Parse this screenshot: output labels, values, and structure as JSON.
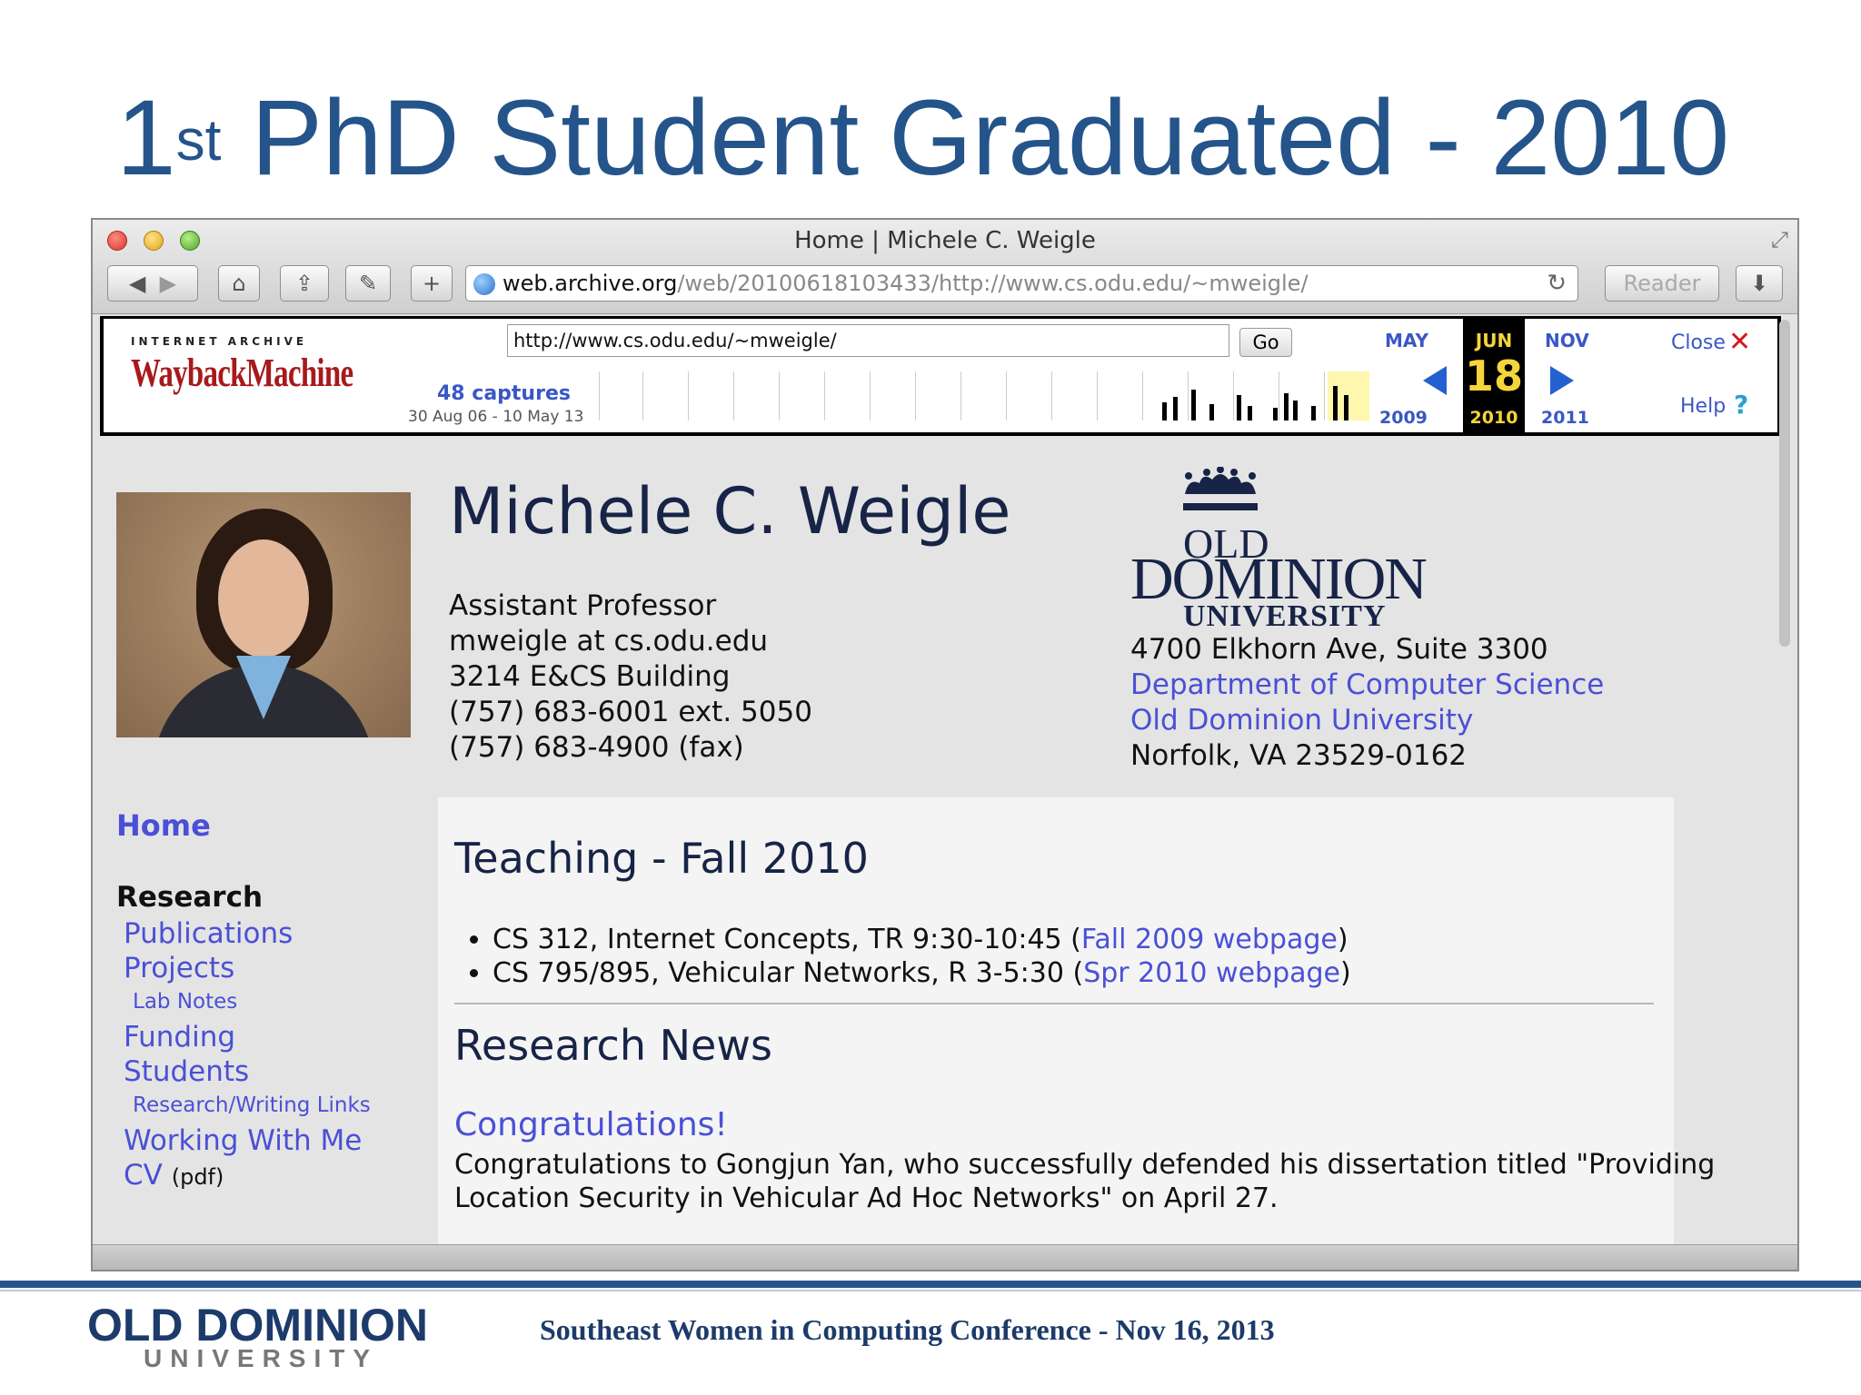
{
  "slide": {
    "title_number": "1",
    "title_sup": "st",
    "title_rest": " PhD Student Graduated - 2010",
    "footer_org_line1": "OLD DOMINION",
    "footer_org_line2": "UNIVERSITY",
    "footer_conference": "Southeast Women in Computing Conference - Nov 16, 2013"
  },
  "browser": {
    "window_title": "Home | Michele C. Weigle",
    "url_domain": "web.archive.org",
    "url_path": "/web/20100618103433/http://www.cs.odu.edu/~mweigle/",
    "reader_label": "Reader",
    "toolbar_icons": [
      "back-icon",
      "forward-icon",
      "home-icon",
      "share-icon",
      "bookmark-icon",
      "add-icon",
      "reload-icon",
      "download-icon"
    ]
  },
  "wayback": {
    "ia_label": "INTERNET ARCHIVE",
    "logo_text": "WaybackMachine",
    "url_input": "http://www.cs.odu.edu/~mweigle/",
    "go_label": "Go",
    "captures": "48 captures",
    "capture_range": "30 Aug 06 - 10 May 13",
    "prev_month": "MAY",
    "prev_year": "2009",
    "current_month": "JUN",
    "current_day": "18",
    "current_year": "2010",
    "next_month": "NOV",
    "next_year": "2011",
    "close_label": "Close",
    "help_label": "Help"
  },
  "profile": {
    "name": "Michele C. Weigle",
    "title": "Assistant Professor",
    "email": "mweigle at cs.odu.edu",
    "office": "3214 E&CS Building",
    "phone": "(757) 683-6001 ext. 5050",
    "fax": "(757) 683-4900 (fax)",
    "logo_line1": "OLD",
    "logo_line2": "DOMINION",
    "logo_line3": "UNIVERSITY",
    "address1": "4700 Elkhorn Ave, Suite 3300",
    "dept_link": "Department of Computer Science",
    "univ_link": "Old Dominion University",
    "city": "Norfolk, VA 23529-0162"
  },
  "nav": {
    "home": "Home",
    "research_heading": "Research",
    "publications": "Publications",
    "projects": "Projects",
    "lab_notes": "Lab Notes",
    "funding": "Funding",
    "students": "Students",
    "writing_links": "Research/Writing Links",
    "working_with_me": "Working With Me",
    "cv": "CV",
    "cv_note": "(pdf)"
  },
  "main": {
    "teaching_heading": "Teaching - Fall 2010",
    "course1": "CS 312, Internet Concepts, TR 9:30-10:45 (",
    "course1_link": "Fall 2009 webpage",
    "course2": "CS 795/895, Vehicular Networks, R 3-5:30 (",
    "course2_link": "Spr 2010 webpage",
    "close_paren": ")",
    "news_heading": "Research News",
    "news_title": "Congratulations!",
    "news_line1": "Congratulations to Gongjun Yan, who successfully defended his dissertation titled \"Providing",
    "news_line2": "Location Security in Vehicular Ad Hoc Networks\" on April 27."
  }
}
